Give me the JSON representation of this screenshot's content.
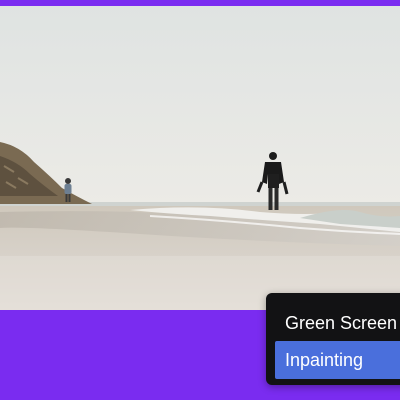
{
  "video": {
    "scene_icon": "beach-video-frame"
  },
  "menu": {
    "items": [
      {
        "label": "Green Screen",
        "selected": false
      },
      {
        "label": "Inpainting",
        "selected": true
      }
    ],
    "selected_color": "#4a6fdc",
    "background_color": "#121214"
  },
  "accent_color": "#7a2cf0"
}
